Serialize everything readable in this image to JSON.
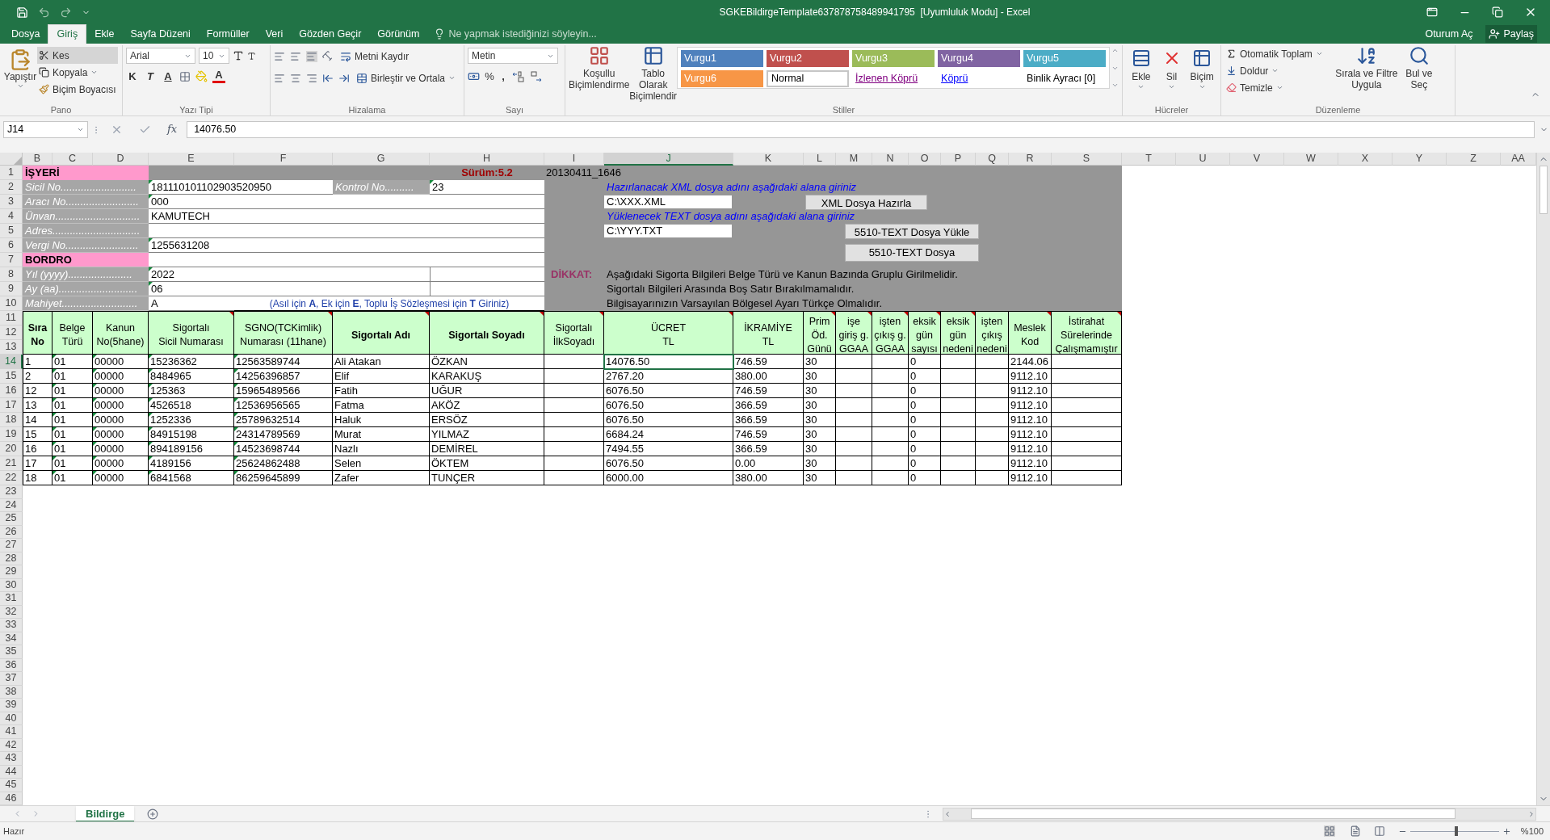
{
  "window": {
    "title": "SGKEBildirgeTemplate637878758489941795  [Uyumluluk Modu] - Excel"
  },
  "ribbon_tabs": [
    {
      "label": "Dosya",
      "selected": false
    },
    {
      "label": "Giriş",
      "selected": true
    },
    {
      "label": "Ekle",
      "selected": false
    },
    {
      "label": "Sayfa Düzeni",
      "selected": false
    },
    {
      "label": "Formüller",
      "selected": false
    },
    {
      "label": "Veri",
      "selected": false
    },
    {
      "label": "Gözden Geçir",
      "selected": false
    },
    {
      "label": "Görünüm",
      "selected": false
    }
  ],
  "tell_me": {
    "placeholder": "Ne yapmak istediğinizi söyleyin..."
  },
  "account": {
    "sign_in": "Oturum Aç",
    "share": "Paylaş"
  },
  "ribbon": {
    "clipboard": {
      "label": "Pano",
      "paste": "Yapıştır",
      "cut": "Kes",
      "copy": "Kopyala",
      "format_painter": "Biçim Boyacısı"
    },
    "font": {
      "label": "Yazı Tipi",
      "family": "Arial",
      "size": "10",
      "bold": "K",
      "italic": "T",
      "underline": "A",
      "font_color": "A"
    },
    "alignment": {
      "label": "Hizalama",
      "wrap": "Metni Kaydır",
      "merge": "Birleştir ve Ortala"
    },
    "number": {
      "label": "Sayı",
      "format": "Metin",
      "percent": "%",
      "comma": ","
    },
    "styles": {
      "label": "Stiller",
      "conditional": "Koşullu\nBiçimlendirme",
      "format_table": "Tablo Olarak\nBiçimlendir",
      "items": [
        {
          "label": "Vurgu1",
          "kind": "fill",
          "color": "#4f81bd"
        },
        {
          "label": "Vurgu2",
          "kind": "fill",
          "color": "#c0504d"
        },
        {
          "label": "Vurgu3",
          "kind": "fill",
          "color": "#9bbb59"
        },
        {
          "label": "Vurgu4",
          "kind": "fill",
          "color": "#8064a2"
        },
        {
          "label": "Vurgu5",
          "kind": "fill",
          "color": "#4bacc6"
        },
        {
          "label": "Vurgu6",
          "kind": "fill",
          "color": "#f79646"
        },
        {
          "label": "Normal",
          "kind": "normal"
        },
        {
          "label": "İzlenen Köprü",
          "kind": "link",
          "color": "#800080"
        },
        {
          "label": "Köprü",
          "kind": "link",
          "color": "#0000ff"
        },
        {
          "label": "Binlik Ayracı [0]",
          "kind": "plain"
        }
      ]
    },
    "cells": {
      "label": "Hücreler",
      "insert": "Ekle",
      "delete": "Sil",
      "format": "Biçim"
    },
    "editing": {
      "label": "Düzenleme",
      "autosum": "Otomatik Toplam",
      "fill": "Doldur",
      "clear": "Temizle",
      "sort": "Sırala ve Filtre\nUygula",
      "find": "Bul ve\nSeç"
    }
  },
  "formula_bar": {
    "name_box": "J14",
    "function_label": "fx",
    "value": "14076.50"
  },
  "sheet": {
    "columns": [
      {
        "label": "B",
        "selected": false
      },
      {
        "label": "C",
        "selected": false
      },
      {
        "label": "D",
        "selected": false
      },
      {
        "label": "E",
        "selected": false
      },
      {
        "label": "F",
        "selected": false
      },
      {
        "label": "G",
        "selected": false
      },
      {
        "label": "H",
        "selected": false
      },
      {
        "label": "I",
        "selected": false
      },
      {
        "label": "J",
        "selected": true
      },
      {
        "label": "K",
        "selected": false
      },
      {
        "label": "L",
        "selected": false
      },
      {
        "label": "M",
        "selected": false
      },
      {
        "label": "N",
        "selected": false
      },
      {
        "label": "O",
        "selected": false
      },
      {
        "label": "P",
        "selected": false
      },
      {
        "label": "Q",
        "selected": false
      },
      {
        "label": "R",
        "selected": false
      },
      {
        "label": "S",
        "selected": false
      },
      {
        "label": "T",
        "selected": false
      },
      {
        "label": "U",
        "selected": false
      },
      {
        "label": "V",
        "selected": false
      },
      {
        "label": "W",
        "selected": false
      },
      {
        "label": "X",
        "selected": false
      },
      {
        "label": "Y",
        "selected": false
      },
      {
        "label": "Z",
        "selected": false
      },
      {
        "label": "AA",
        "selected": false
      }
    ],
    "row_numbers": [
      {
        "label": "1",
        "selected": false
      },
      {
        "label": "2",
        "selected": false
      },
      {
        "label": "3",
        "selected": false
      },
      {
        "label": "4",
        "selected": false
      },
      {
        "label": "5",
        "selected": false
      },
      {
        "label": "6",
        "selected": false
      },
      {
        "label": "7",
        "selected": false
      },
      {
        "label": "8",
        "selected": false
      },
      {
        "label": "9",
        "selected": false
      },
      {
        "label": "10",
        "selected": false
      },
      {
        "label": "11",
        "selected": false
      },
      {
        "label": "12",
        "selected": false
      },
      {
        "label": "13",
        "selected": false
      },
      {
        "label": "14",
        "selected": true
      },
      {
        "label": "15",
        "selected": false
      },
      {
        "label": "16",
        "selected": false
      },
      {
        "label": "17",
        "selected": false
      },
      {
        "label": "18",
        "selected": false
      },
      {
        "label": "19",
        "selected": false
      },
      {
        "label": "20",
        "selected": false
      },
      {
        "label": "21",
        "selected": false
      },
      {
        "label": "22",
        "selected": false
      },
      {
        "label": "23",
        "selected": false
      },
      {
        "label": "24",
        "selected": false
      },
      {
        "label": "25",
        "selected": false
      },
      {
        "label": "26",
        "selected": false
      },
      {
        "label": "27",
        "selected": false
      },
      {
        "label": "28",
        "selected": false
      },
      {
        "label": "29",
        "selected": false
      },
      {
        "label": "30",
        "selected": false
      },
      {
        "label": "31",
        "selected": false
      },
      {
        "label": "32",
        "selected": false
      },
      {
        "label": "33",
        "selected": false
      },
      {
        "label": "34",
        "selected": false
      },
      {
        "label": "35",
        "selected": false
      },
      {
        "label": "36",
        "selected": false
      },
      {
        "label": "37",
        "selected": false
      },
      {
        "label": "38",
        "selected": false
      },
      {
        "label": "39",
        "selected": false
      },
      {
        "label": "40",
        "selected": false
      },
      {
        "label": "41",
        "selected": false
      },
      {
        "label": "42",
        "selected": false
      },
      {
        "label": "43",
        "selected": false
      },
      {
        "label": "44",
        "selected": false
      },
      {
        "label": "45",
        "selected": false
      },
      {
        "label": "46",
        "selected": false
      }
    ],
    "workplace_title": "İŞYERİ",
    "version": "Sürüm:5.2",
    "build": "20130411_1646",
    "form_rows": [
      {
        "kind": "pair",
        "label": "Sicil No..........................",
        "value": "181110101102903520950",
        "flag": true,
        "label_2": "Kontrol No..........",
        "value_2": "23",
        "flag_2": true
      },
      {
        "kind": "wide",
        "label": "Aracı No.........................",
        "value": "000",
        "flag": true
      },
      {
        "kind": "wide",
        "label": "Ünvan.............................",
        "value": "KAMUTECH",
        "flag": false
      },
      {
        "kind": "wide",
        "label": "Adres..............................",
        "flag": false
      },
      {
        "kind": "wide",
        "label": "Vergi No.........................",
        "value": "1255631208",
        "flag": true
      },
      {
        "kind": "section",
        "label": "BORDRO"
      },
      {
        "kind": "split",
        "label": "Yıl (yyyy)......................",
        "value": "2022",
        "flag": true
      },
      {
        "kind": "split",
        "label": "Ay (aa)...........................",
        "value": "06",
        "flag": true
      },
      {
        "kind": "note",
        "label": "Mahiyet..........................",
        "value": "A",
        "flag": false,
        "note": "(Asıl için **A**, Ek için **E**, Toplu İş Sözleşmesi için **T** Giriniz)"
      }
    ],
    "export_panel": {
      "xml_hint": "Hazırlanacak XML dosya adını aşağıdaki alana giriniz",
      "xml_path": "C:\\XXX.XML",
      "xml_button": "XML Dosya Hazırla",
      "text_hint": "Yüklenecek TEXT dosya adını aşağıdaki alana giriniz",
      "text_path": "C:\\YYY.TXT",
      "upload_button": "5510-TEXT Dosya Yükle",
      "text_button": "5510-TEXT Dosya"
    },
    "notice": {
      "title": "DİKKAT:",
      "lines": [
        "Aşağıdaki Sigorta Bilgileri Belge Türü ve Kanun Bazında Gruplu Girilmelidir.",
        "Sigortalı Bilgileri Arasında Boş Satır Bırakılmamalıdır.",
        "Bilgisayarınızın Varsayılan Bölgesel Ayarı Türkçe Olmalıdır."
      ]
    },
    "table": {
      "columns": [
        {
          "label": "Sıra\nNo",
          "bold": true,
          "comment": false,
          "flag": false
        },
        {
          "label": "Belge\nTürü",
          "bold": false,
          "comment": false,
          "flag": true
        },
        {
          "label": "Kanun\nNo(5hane)",
          "bold": false,
          "comment": false,
          "flag": true
        },
        {
          "label": "Sigortalı\nSicil Numarası",
          "bold": false,
          "comment": true,
          "flag": true
        },
        {
          "label": "SGNO(TCKimlik)\nNumarası (11hane)",
          "bold": false,
          "comment": true,
          "flag": true
        },
        {
          "label": "Sigortalı Adı",
          "bold": true,
          "comment": true,
          "flag": false
        },
        {
          "label": "Sigortalı Soyadı",
          "bold": true,
          "comment": true,
          "flag": false
        },
        {
          "label": "Sigortalı\nİlkSoyadı",
          "bold": false,
          "comment": true,
          "flag": false
        },
        {
          "label": "ÜCRET\nTL",
          "bold": false,
          "comment": true,
          "flag": false
        },
        {
          "label": "İKRAMİYE\nTL",
          "bold": false,
          "comment": false,
          "flag": false
        },
        {
          "label": "Prim\nÖd.\nGünü",
          "bold": false,
          "comment": true,
          "flag": false
        },
        {
          "label": "işe\ngiriş g.\nGGAA",
          "bold": false,
          "comment": true,
          "flag": false
        },
        {
          "label": "işten\nçıkış g.\nGGAA",
          "bold": false,
          "comment": true,
          "flag": false
        },
        {
          "label": "eksik\ngün\nsayısı",
          "bold": false,
          "comment": true,
          "flag": false
        },
        {
          "label": "eksik\ngün\nnedeni",
          "bold": false,
          "comment": true,
          "flag": false
        },
        {
          "label": "işten\nçıkış\nnedeni",
          "bold": false,
          "comment": false,
          "flag": false
        },
        {
          "label": "Meslek\nKod",
          "bold": false,
          "comment": true,
          "flag": false
        },
        {
          "label": "İstirahat\nSürelerinde\nÇalışmamıştır",
          "bold": false,
          "comment": true,
          "flag": false
        }
      ],
      "rows": [
        {
          "selected": true,
          "cells": [
            "1",
            "01",
            "00000",
            "15236362",
            "12563589744",
            "Ali Atakan",
            "ÖZKAN",
            null,
            "14076.50",
            "746.59",
            "30",
            null,
            null,
            "0",
            null,
            null,
            "2144.06",
            null
          ]
        },
        {
          "selected": false,
          "cells": [
            "2",
            "01",
            "00000",
            "8484965",
            "14256396857",
            "Elif",
            "KARAKUŞ",
            null,
            "2767.20",
            "380.00",
            "30",
            null,
            null,
            "0",
            null,
            null,
            "9112.10",
            null
          ]
        },
        {
          "selected": false,
          "cells": [
            "12",
            "01",
            "00000",
            "125363",
            "15965489566",
            "Fatih",
            "UĞUR",
            null,
            "6076.50",
            "746.59",
            "30",
            null,
            null,
            "0",
            null,
            null,
            "9112.10",
            null
          ]
        },
        {
          "selected": false,
          "cells": [
            "13",
            "01",
            "00000",
            "4526518",
            "12536956565",
            "Fatma",
            "AKÖZ",
            null,
            "6076.50",
            "366.59",
            "30",
            null,
            null,
            "0",
            null,
            null,
            "9112.10",
            null
          ]
        },
        {
          "selected": false,
          "cells": [
            "14",
            "01",
            "00000",
            "1252336",
            "25789632514",
            "Haluk",
            "ERSÖZ",
            null,
            "6076.50",
            "366.59",
            "30",
            null,
            null,
            "0",
            null,
            null,
            "9112.10",
            null
          ]
        },
        {
          "selected": false,
          "cells": [
            "15",
            "01",
            "00000",
            "84915198",
            "24314789569",
            "Murat",
            "YILMAZ",
            null,
            "6684.24",
            "746.59",
            "30",
            null,
            null,
            "0",
            null,
            null,
            "9112.10",
            null
          ]
        },
        {
          "selected": false,
          "cells": [
            "16",
            "01",
            "00000",
            "894189156",
            "14523698744",
            "Nazlı",
            "DEMİREL",
            null,
            "7494.55",
            "366.59",
            "30",
            null,
            null,
            "0",
            null,
            null,
            "9112.10",
            null
          ]
        },
        {
          "selected": false,
          "cells": [
            "17",
            "01",
            "00000",
            "4189156",
            "25624862488",
            "Selen",
            "ÖKTEM",
            null,
            "6076.50",
            "0.00",
            "30",
            null,
            null,
            "0",
            null,
            null,
            "9112.10",
            null
          ]
        },
        {
          "selected": false,
          "cells": [
            "18",
            "01",
            "00000",
            "6841568",
            "86259645899",
            "Zafer",
            "TUNÇER",
            null,
            "6000.00",
            "380.00",
            "30",
            null,
            null,
            "0",
            null,
            null,
            "9112.10",
            null
          ]
        }
      ]
    }
  },
  "sheet_tabs": [
    {
      "label": "Bildirge",
      "selected": true
    }
  ],
  "status_bar": {
    "text": "Hazır",
    "zoom": "%100",
    "zoom_level": {
      "level": 0.5
    }
  }
}
